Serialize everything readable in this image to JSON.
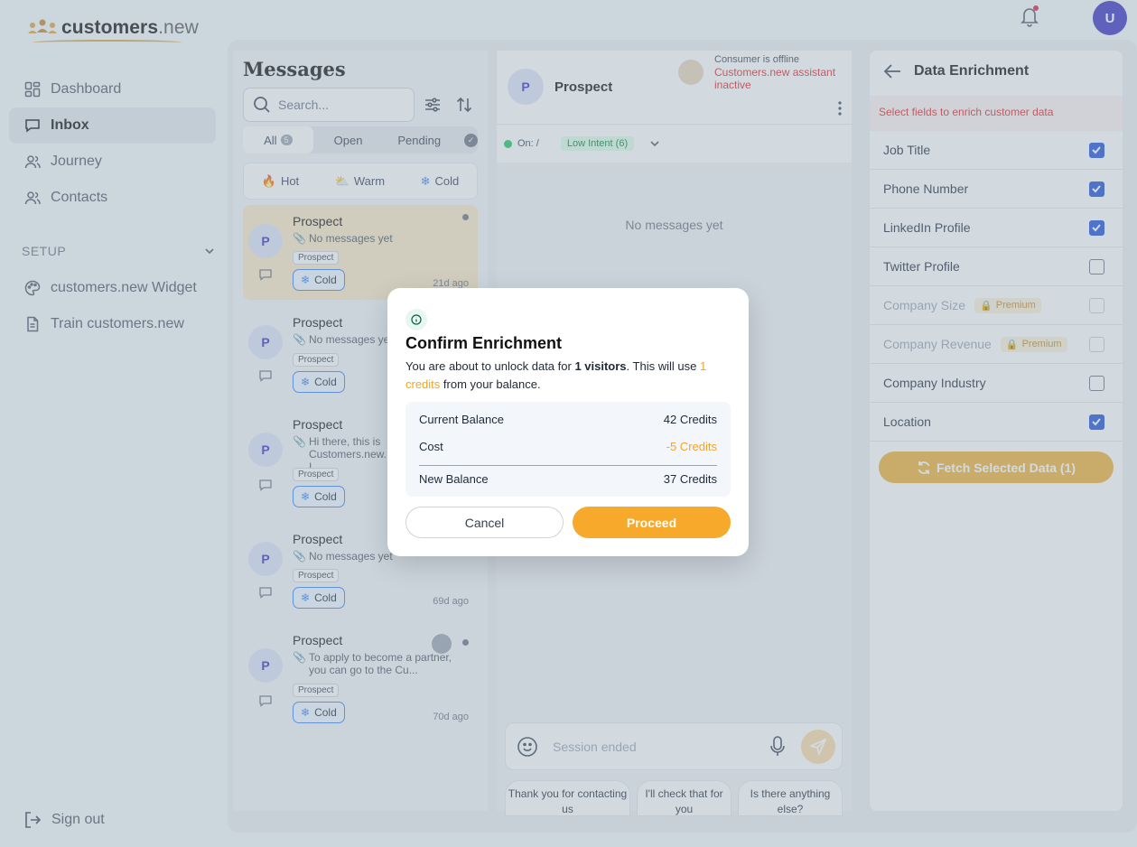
{
  "app": {
    "logo_main": "customers",
    "logo_suffix": ".new",
    "user_initial": "U"
  },
  "sidebar": {
    "items": [
      {
        "label": "Dashboard",
        "icon": "grid-icon"
      },
      {
        "label": "Inbox",
        "icon": "chat-icon",
        "active": true
      },
      {
        "label": "Journey",
        "icon": "users-icon"
      },
      {
        "label": "Contacts",
        "icon": "users-icon"
      }
    ],
    "setup_label": "SETUP",
    "setup_items": [
      {
        "label": "customers.new Widget",
        "icon": "palette-icon"
      },
      {
        "label": "Train customers.new",
        "icon": "document-icon"
      }
    ],
    "signout_label": "Sign out"
  },
  "messages": {
    "title": "Messages",
    "search_placeholder": "Search...",
    "tabs": [
      {
        "label": "All",
        "count": "5",
        "active": true
      },
      {
        "label": "Open"
      },
      {
        "label": "Pending"
      }
    ],
    "temps": [
      {
        "label": "Hot",
        "icon": "fire-icon"
      },
      {
        "label": "Warm",
        "icon": "sun-cloud-icon"
      },
      {
        "label": "Cold",
        "icon": "snowflake-icon"
      }
    ],
    "conversations": [
      {
        "initial": "P",
        "name": "Prospect",
        "preview": "No messages yet",
        "tag": "Prospect",
        "temp": "Cold",
        "time": "21d ago"
      },
      {
        "initial": "P",
        "name": "Prospect",
        "preview": "No messages yet",
        "tag": "Prospect",
        "temp": "Cold",
        "time": ""
      },
      {
        "initial": "P",
        "name": "Prospect",
        "preview": "Hi there, this is Customers.new. I",
        "tag": "Prospect",
        "temp": "Cold",
        "time": ""
      },
      {
        "initial": "P",
        "name": "Prospect",
        "preview": "No messages yet",
        "tag": "Prospect",
        "temp": "Cold",
        "time": "69d ago"
      },
      {
        "initial": "P",
        "name": "Prospect",
        "preview": "To apply to become a partner, you can go to the Cu...",
        "tag": "Prospect",
        "temp": "Cold",
        "time": "70d ago"
      }
    ]
  },
  "chat": {
    "contact_initial": "P",
    "contact_name": "Prospect",
    "offline_text": "Consumer is offline",
    "assistant_status": "Customers.new assistant inactive",
    "on_label": "On: /",
    "intent_label": "Low Intent (6)",
    "empty_text": "No messages yet",
    "composer_placeholder": "Session ended",
    "suggestions": [
      "Thank you for contacting us",
      "I'll check that for you",
      "Is there anything else?"
    ]
  },
  "enrichment": {
    "title": "Data Enrichment",
    "instruction": "Select fields to enrich customer data",
    "premium_label": "Premium",
    "fields": [
      {
        "label": "Job Title",
        "checked": true
      },
      {
        "label": "Phone Number",
        "checked": true
      },
      {
        "label": "LinkedIn Profile",
        "checked": true
      },
      {
        "label": "Twitter Profile",
        "checked": false
      },
      {
        "label": "Company Size",
        "checked": false,
        "premium": true
      },
      {
        "label": "Company Revenue",
        "checked": false,
        "premium": true
      },
      {
        "label": "Company Industry",
        "checked": false
      },
      {
        "label": "Location",
        "checked": true
      }
    ],
    "fetch_label": "Fetch Selected Data (1)"
  },
  "modal": {
    "title": "Confirm Enrichment",
    "text_pre": "You are about to unlock data for ",
    "visitors": "1 visitors",
    "text_mid": ". This will use ",
    "credits": "1 credits",
    "text_post": " from your balance.",
    "rows": [
      {
        "label": "Current Balance",
        "value": "42 Credits"
      },
      {
        "label": "Cost",
        "value": "-5 Credits"
      },
      {
        "label": "New Balance",
        "value": "37 Credits"
      }
    ],
    "cancel_label": "Cancel",
    "proceed_label": "Proceed"
  },
  "colors": {
    "accent": "#f6a92b",
    "brand": "#3b2fc1",
    "danger": "#dc2626",
    "checkbox": "#1d4ed8"
  }
}
